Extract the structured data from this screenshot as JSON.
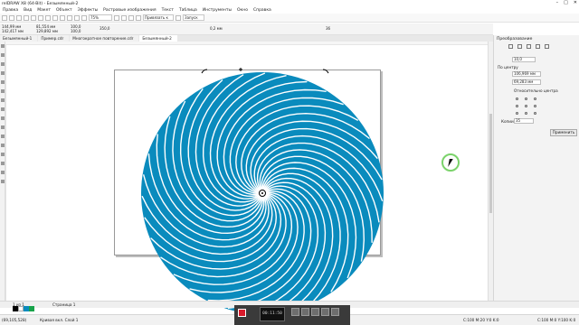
{
  "window": {
    "title": "reIDRAW X8 (64-Bit) - Безымянный-2",
    "minimize": "–",
    "maximize": "□",
    "close": "✕"
  },
  "menu": [
    "Правка",
    "Вид",
    "Макет",
    "Объект",
    "Эффекты",
    "Растровые изображения",
    "Текст",
    "Таблица",
    "Инструменты",
    "Окно",
    "Справка"
  ],
  "toolbar": {
    "zoom": "75%",
    "snap": "Привязать к",
    "launch": "Запуск"
  },
  "propbar": {
    "x": "144,99 мм",
    "y": "142,417 мм",
    "w": "81,554 мм",
    "h": "129,892 мм",
    "sx": "100,0",
    "sy": "100,0",
    "angle": "350,0",
    "outline": "0,2 мм",
    "nib": "36"
  },
  "doc_tabs": [
    "Безымянный-1",
    "Пример.cdr",
    "Многократное повторение.cdr",
    "Безымянный-2"
  ],
  "artwork": {
    "fill_color": "#0a8bbd",
    "stroke_color": "#ffffff",
    "background": "#ffffff"
  },
  "panel": {
    "title": "Преобразование",
    "rotation": "10,0",
    "center_label": "По центру",
    "cx": "106,969 мм",
    "cy": "69,283 мм",
    "relative": "Относительно центра",
    "copies_label": "Копии:",
    "copies": "35",
    "apply": "Применить"
  },
  "bottom": {
    "page_nav": "1 из 1",
    "page_tab": "Страница 1"
  },
  "status": {
    "coords": "(69,105,528)",
    "curve": "Кривая вкл. Слой 1",
    "fill_info": "C:100 M:20 Y:0 K:0",
    "outline_info": "C:100 M:0 Y:100 K:0"
  },
  "recorder": {
    "time": "00:11:50"
  }
}
